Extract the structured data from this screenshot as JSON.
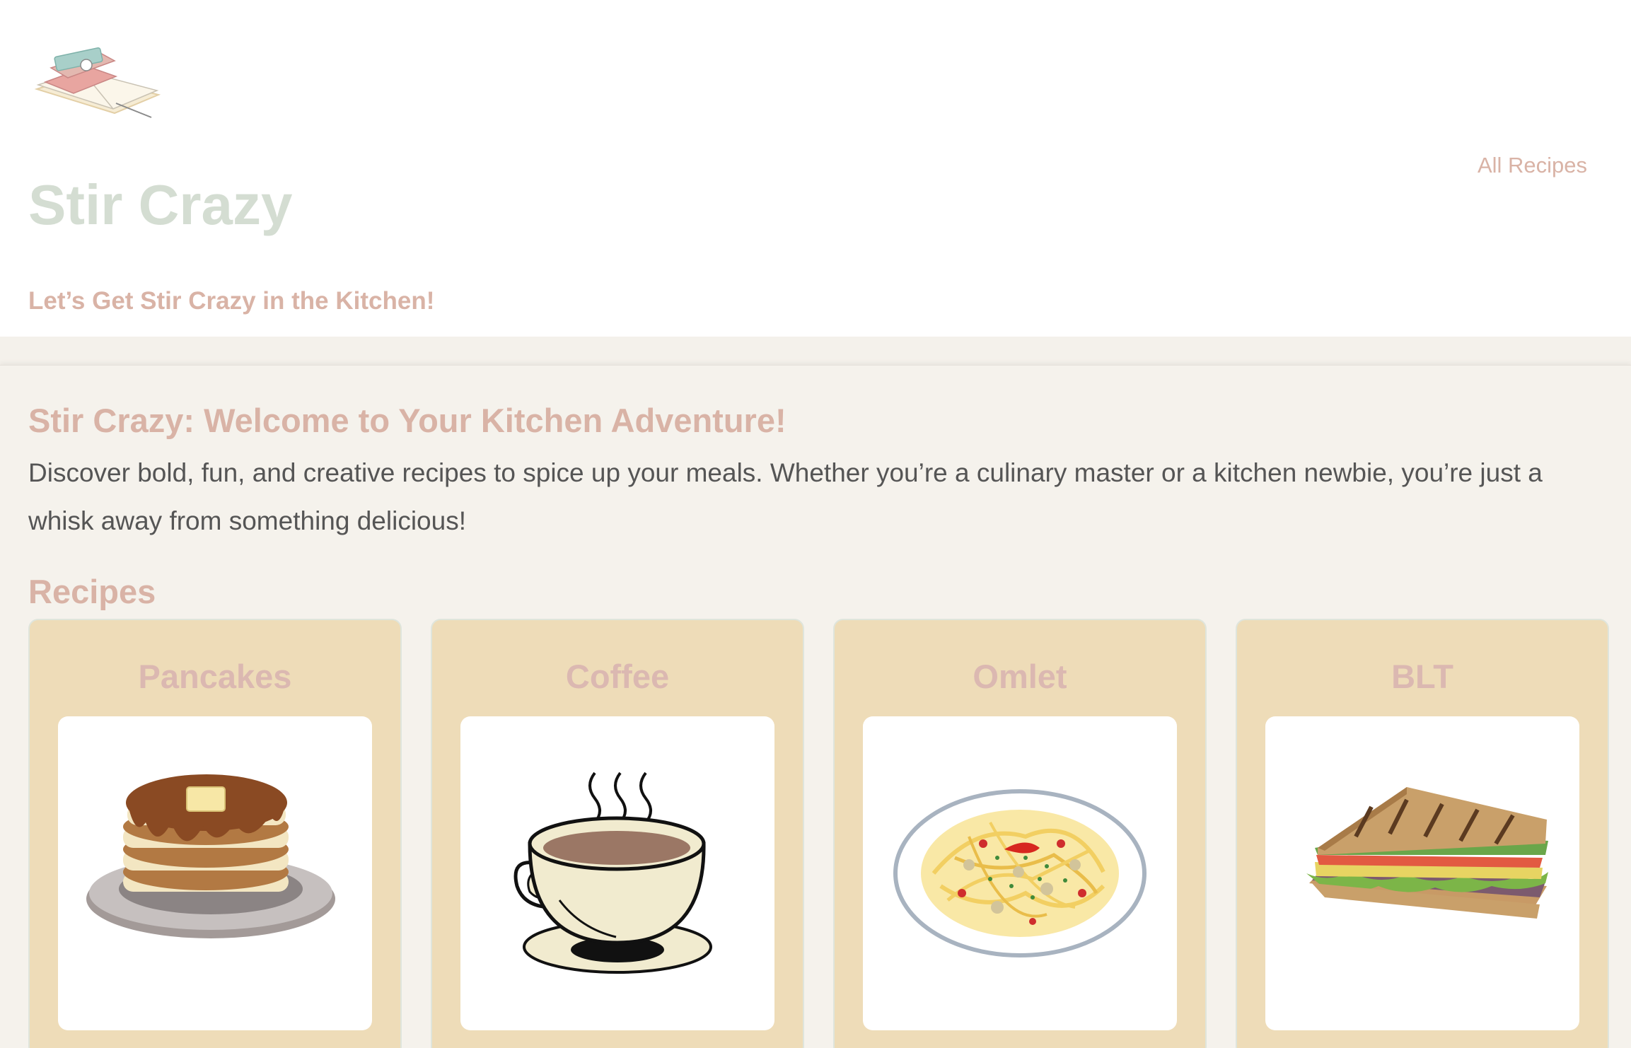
{
  "header": {
    "site_title": "Stir Crazy",
    "tagline": "Let’s Get Stir Crazy in the Kitchen!",
    "nav_all_recipes": "All Recipes",
    "logo_icon": "cookbook-stack-icon"
  },
  "main": {
    "welcome_title": "Stir Crazy: Welcome to Your Kitchen Adventure!",
    "intro": "Discover bold, fun, and creative recipes to spice up your meals. Whether you’re a culinary master or a kitchen newbie, you’re just a whisk away from something delicious!",
    "recipes_heading": "Recipes",
    "recipes": [
      {
        "title": "Pancakes",
        "icon": "pancakes-icon"
      },
      {
        "title": "Coffee",
        "icon": "coffee-cup-icon"
      },
      {
        "title": "Omlet",
        "icon": "pasta-plate-icon"
      },
      {
        "title": "BLT",
        "icon": "sandwich-icon"
      }
    ]
  },
  "colors": {
    "title_green": "#d4ddd2",
    "accent_pink": "#d9b3a6",
    "card_bg": "#eedcb8",
    "page_bg": "#f5f2ec"
  }
}
